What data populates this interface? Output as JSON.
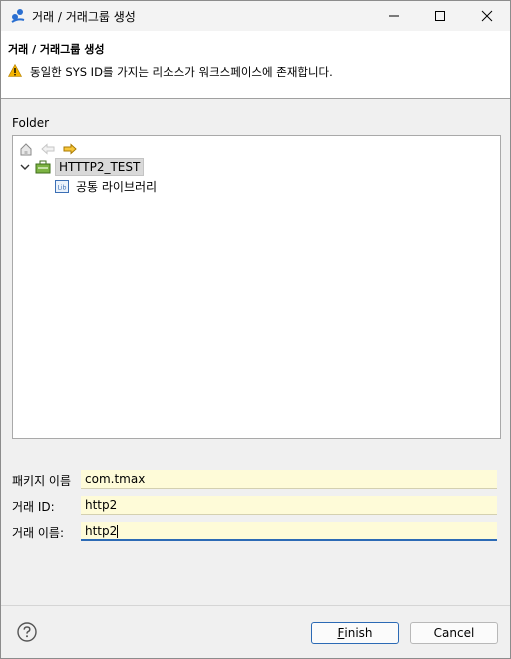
{
  "window": {
    "title": "거래 / 거래그룹 생성"
  },
  "banner": {
    "title": "거래 / 거래그룹 생성",
    "message": "동일한 SYS ID를 가지는 리소스가 워크스페이스에 존재합니다."
  },
  "folder": {
    "label": "Folder",
    "tree": {
      "root": {
        "label": "HTTTP2_TEST",
        "expanded": true,
        "icon": "project-icon"
      },
      "children": [
        {
          "label": "공통 라이브러리",
          "icon": "library-icon"
        }
      ]
    }
  },
  "form": {
    "package": {
      "label": "패키지 이름",
      "value": "com.tmax"
    },
    "tx_id": {
      "label": "거래 ID:",
      "value": "http2"
    },
    "tx_name": {
      "label": "거래 이름:",
      "value": "http2"
    }
  },
  "buttons": {
    "finish_first": "F",
    "finish_rest": "inish",
    "cancel": "Cancel"
  },
  "colors": {
    "input_bg": "#fefbd8",
    "focus_border": "#2c6ab5",
    "warning": "#f5b400"
  }
}
